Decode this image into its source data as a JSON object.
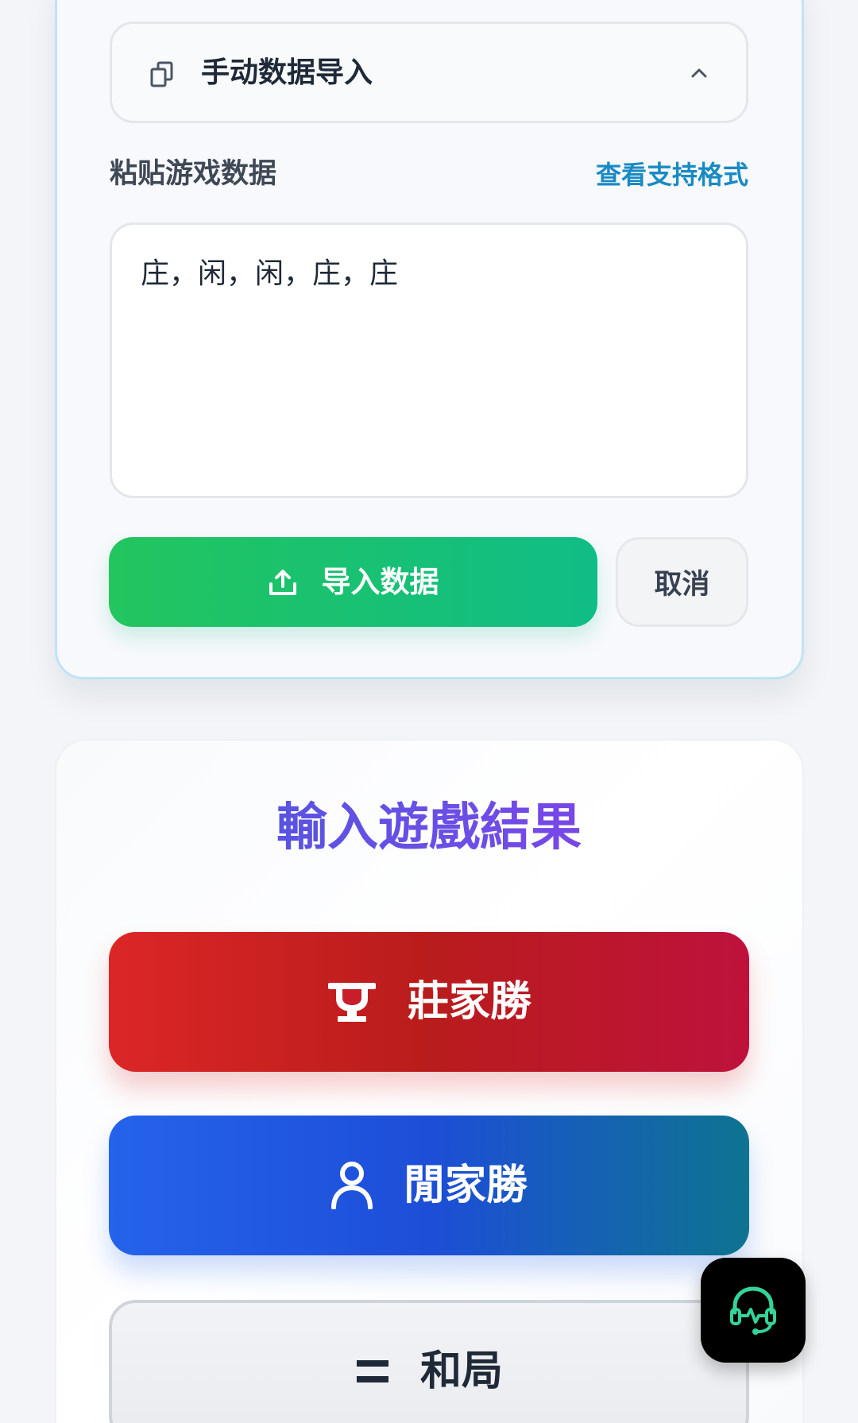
{
  "import_panel": {
    "header_title": "手动数据导入",
    "paste_label": "粘贴游戏数据",
    "formats_link": "查看支持格式",
    "textarea_value": "庄，闲，闲，庄，庄",
    "import_button_label": "导入数据",
    "cancel_button_label": "取消",
    "icons": {
      "header": "copy-icon",
      "collapse": "chevron-up-icon",
      "import": "upload-icon"
    },
    "colors": {
      "import_green": "#22c55e",
      "link_blue": "#1a8ac3",
      "card_border": "#bfe3f7"
    }
  },
  "result_panel": {
    "title": "輸入遊戲結果",
    "buttons": {
      "banker": {
        "label": "莊家勝",
        "icon": "trophy-icon"
      },
      "player": {
        "label": "閒家勝",
        "icon": "user-icon"
      },
      "tie": {
        "label": "和局",
        "icon": "equals-icon"
      }
    },
    "colors": {
      "title_start": "#3b5bdb",
      "title_end": "#9333ea",
      "banker_red": "#dc2626",
      "player_blue": "#2563eb"
    }
  },
  "support_fab": {
    "icon": "headset-icon",
    "accent": "#34d399"
  }
}
